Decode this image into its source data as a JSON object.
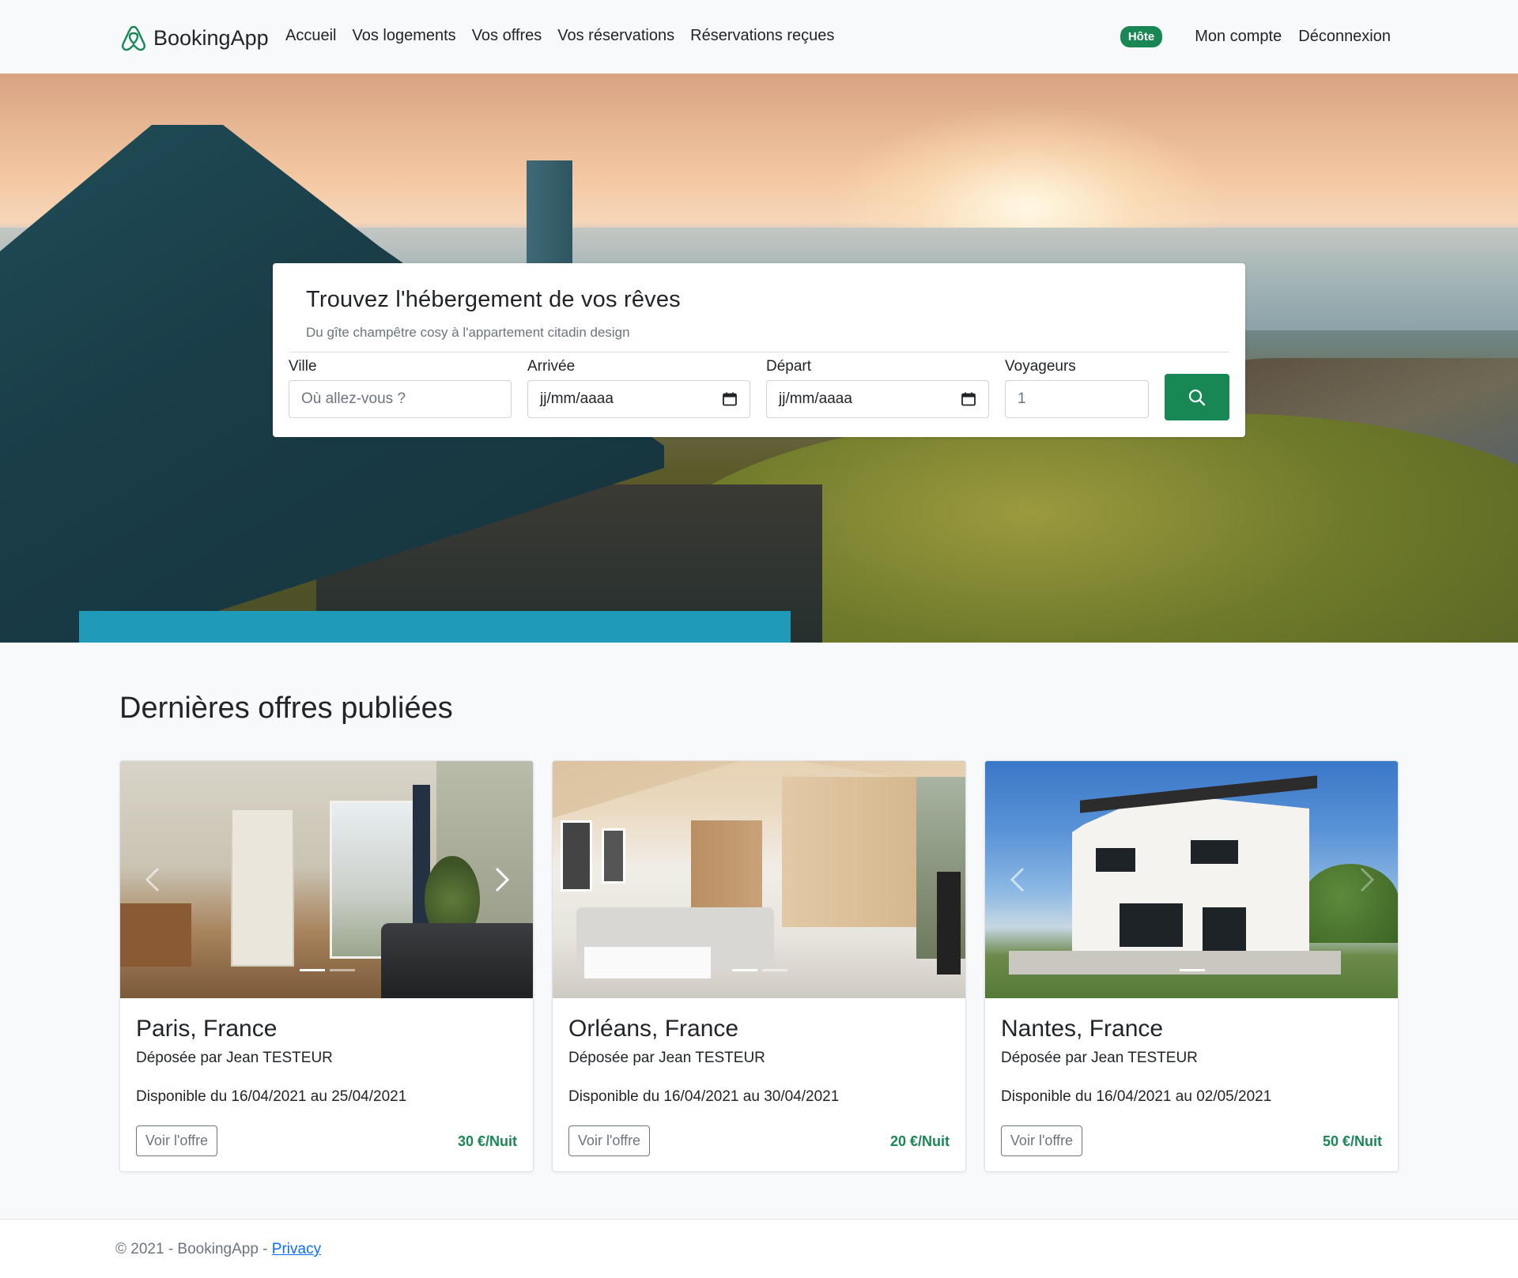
{
  "navbar": {
    "brand": "BookingApp",
    "links": [
      "Accueil",
      "Vos logements",
      "Vos offres",
      "Vos réservations",
      "Réservations reçues"
    ],
    "badge": "Hôte",
    "account": "Mon compte",
    "logout": "Déconnexion"
  },
  "search": {
    "title": "Trouvez l'hébergement de vos rêves",
    "subtitle": "Du gîte champêtre cosy à l'appartement citadin design",
    "city_label": "Ville",
    "city_placeholder": "Où allez-vous ?",
    "arrival_label": "Arrivée",
    "arrival_value": "jj/mm/aaaa",
    "departure_label": "Départ",
    "departure_value": "jj/mm/aaaa",
    "guests_label": "Voyageurs",
    "guests_value": "1"
  },
  "offers": {
    "title": "Dernières offres publiées",
    "items": [
      {
        "city": "Paris, France",
        "owner": "Déposée par Jean TESTEUR",
        "availability": "Disponible du 16/04/2021 au 25/04/2021",
        "button": "Voir l'offre",
        "price": "30 €/Nuit"
      },
      {
        "city": "Orléans, France",
        "owner": "Déposée par Jean TESTEUR",
        "availability": "Disponible du 16/04/2021 au 30/04/2021",
        "button": "Voir l'offre",
        "price": "20 €/Nuit"
      },
      {
        "city": "Nantes, France",
        "owner": "Déposée par Jean TESTEUR",
        "availability": "Disponible du 16/04/2021 au 02/05/2021",
        "button": "Voir l'offre",
        "price": "50 €/Nuit"
      }
    ]
  },
  "footer": {
    "text": "© 2021 - BookingApp - ",
    "privacy": "Privacy"
  },
  "colors": {
    "brand": "#198754",
    "background": "#f8f9fa",
    "link": "#0d6efd"
  },
  "icons": {
    "brand": "airbnb-logo-icon",
    "date": "calendar-icon",
    "search": "search-icon",
    "carousel_prev": "chevron-left-icon",
    "carousel_next": "chevron-right-icon"
  }
}
